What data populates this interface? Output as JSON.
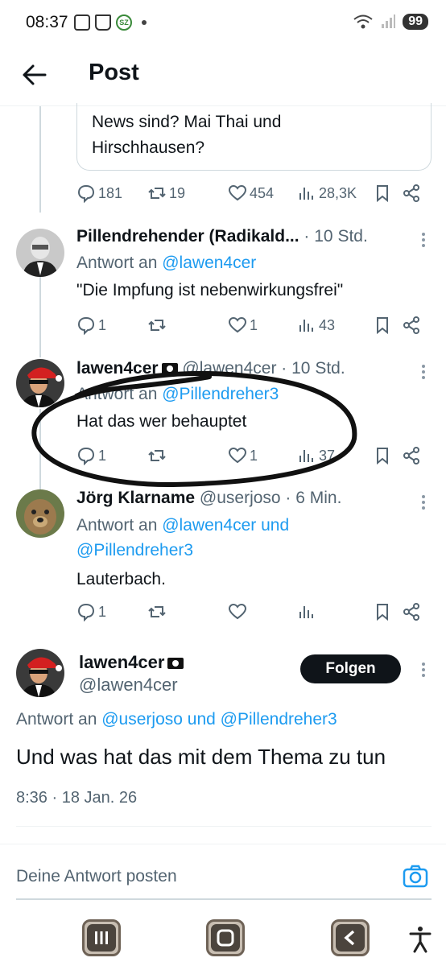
{
  "status_bar": {
    "time": "08:37",
    "battery": "99"
  },
  "header": {
    "title": "Post"
  },
  "quoted_post": {
    "text_line1": "News sind? Mai Thai und",
    "text_line2": "Hirschhausen?"
  },
  "top_actions": {
    "replies": "181",
    "reposts": "19",
    "likes": "454",
    "views": "28,3K"
  },
  "posts": [
    {
      "name": "Pillendrehender (Radikald...",
      "meta": "· 10 Std.",
      "replyto_prefix": "Antwort an",
      "replyto_users": "@lawen4cer",
      "text": "\"Die Impfung ist nebenwirkungsfrei\"",
      "replies": "1",
      "reposts": "",
      "likes": "1",
      "views": "43"
    },
    {
      "name": "lawen4cer",
      "meta": "@lawen4cer · 10 Std.",
      "replyto_prefix": "Antwort an",
      "replyto_users": "@Pillendreher3",
      "text": "Hat das wer behauptet",
      "replies": "1",
      "reposts": "",
      "likes": "1",
      "views": "37"
    },
    {
      "name": "Jörg Klarname",
      "meta": "@userjoso · 6 Min.",
      "replyto_prefix": "Antwort an",
      "replyto_users_line1": "@lawen4cer und",
      "replyto_users_line2": "@Pillendreher3",
      "text": "Lauterbach.",
      "replies": "1",
      "reposts": "",
      "likes": "",
      "views": ""
    }
  ],
  "main_post": {
    "name": "lawen4cer",
    "handle": "@lawen4cer",
    "follow_label": "Folgen",
    "replyto_prefix": "Antwort an",
    "replyto_users": "@userjoso und @Pillendreher3",
    "text": "Und was hat das mit dem Thema zu tun",
    "timestamp": "8:36 · 18 Jan. 26"
  },
  "compose": {
    "placeholder": "Deine Antwort posten"
  },
  "colors": {
    "accent": "#1d9bf0",
    "text": "#0f1419",
    "secondary": "#536471"
  }
}
